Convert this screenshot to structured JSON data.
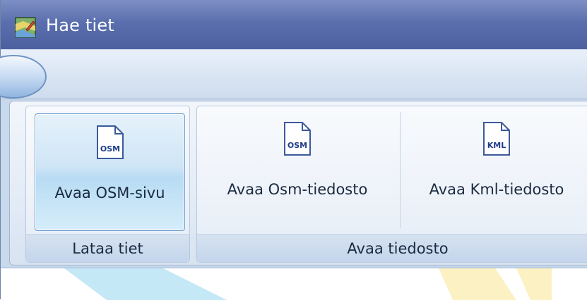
{
  "window": {
    "title": "Hae tiet",
    "icon": "map-app-icon"
  },
  "ribbon": {
    "groups": [
      {
        "label": "Lataa tiet",
        "buttons": [
          {
            "label": "Avaa OSM-sivu",
            "icon": "osm-file-icon",
            "icon_text": "OSM"
          }
        ]
      },
      {
        "label": "Avaa tiedosto",
        "buttons": [
          {
            "label": "Avaa Osm-tiedosto",
            "icon": "osm-file-icon",
            "icon_text": "OSM"
          },
          {
            "label": "Avaa Kml-tiedosto",
            "icon": "kml-file-icon",
            "icon_text": "KML"
          }
        ]
      }
    ]
  },
  "colors": {
    "titlebar": "#5b6fae",
    "ribbon": "#e3ebf6",
    "active_button": "#cfe5f6",
    "icon_text": "#1f3d8a"
  }
}
